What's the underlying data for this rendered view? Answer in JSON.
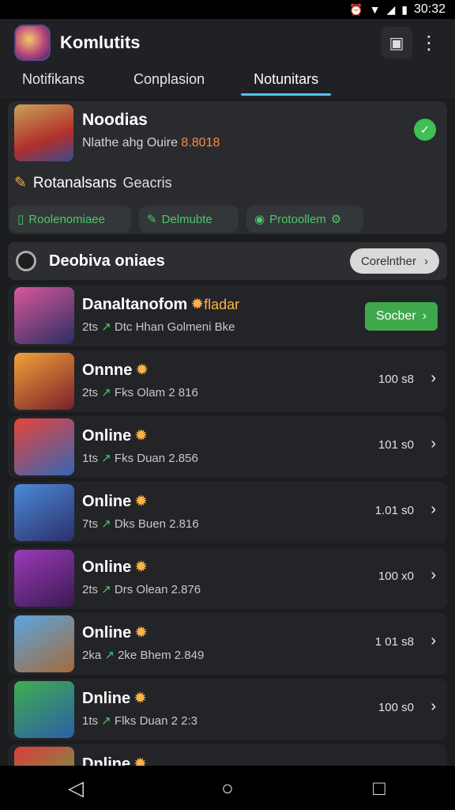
{
  "status_bar": {
    "time": "30:32",
    "icons": [
      "alarm-icon",
      "wifi-icon",
      "signal-icon",
      "battery-icon"
    ]
  },
  "app": {
    "title": "Komlutits"
  },
  "tabs": [
    {
      "label": "Notifikans",
      "active": false
    },
    {
      "label": "Conplasion",
      "active": false
    },
    {
      "label": "Notunitars",
      "active": true
    }
  ],
  "profile": {
    "name": "Noodias",
    "subtitle": "Nlathe ahg Ouire",
    "amount": "8.8018",
    "line_left": "Rotanalsans",
    "line_right": "Geacris",
    "chips": [
      "Roolenomiaee",
      "Delmubte",
      "Protoollem"
    ]
  },
  "section": {
    "title": "Deobiva oniaes",
    "button": "Corelnther"
  },
  "items": [
    {
      "title": "Danaltanofom",
      "tag": "fladar",
      "meta_pre": "2ts",
      "meta": "Dtc Hhan Golmeni Bke",
      "count": "",
      "cta": "Socber",
      "thumb": [
        "#d8589a",
        "#2b2e63"
      ]
    },
    {
      "title": "Onnne",
      "tag": "",
      "meta_pre": "2ts",
      "meta": "Fks Olam 2 816",
      "count": "100 s8",
      "cta": "",
      "thumb": [
        "#f2a23a",
        "#7a1e2a"
      ]
    },
    {
      "title": "Online",
      "tag": "",
      "meta_pre": "1ts",
      "meta": "Fks Duan 2.856",
      "count": "101 s0",
      "cta": "",
      "thumb": [
        "#e8433a",
        "#3566b5"
      ]
    },
    {
      "title": "Online",
      "tag": "",
      "meta_pre": "7ts",
      "meta": "Dks Buen 2.816",
      "count": "1.01 s0",
      "cta": "",
      "thumb": [
        "#4a8bd8",
        "#2c2f6a"
      ]
    },
    {
      "title": "Online",
      "tag": "",
      "meta_pre": "2ts",
      "meta": "Drs Olean 2.876",
      "count": "100 x0",
      "cta": "",
      "thumb": [
        "#9c3ab8",
        "#3a1a52"
      ]
    },
    {
      "title": "Online",
      "tag": "",
      "meta_pre": "2ka",
      "meta": "2ke Bhem 2.849",
      "count": "1 01 s8",
      "cta": "",
      "thumb": [
        "#5aa6e0",
        "#a46a3a"
      ]
    },
    {
      "title": "Dnline",
      "tag": "",
      "meta_pre": "1ts",
      "meta": "Flks Duan 2 2:3",
      "count": "100 s0",
      "cta": "",
      "thumb": [
        "#3fae4f",
        "#2c5ea6"
      ]
    },
    {
      "title": "Dnline",
      "tag": "",
      "meta_pre": "",
      "meta": "",
      "count": "",
      "cta": "",
      "thumb": [
        "#e03a3a",
        "#4fb04a"
      ]
    }
  ],
  "colors": {
    "accent_tab": "#4fc3f7",
    "green": "#3fa84c",
    "amount": "#ff8a3d"
  }
}
